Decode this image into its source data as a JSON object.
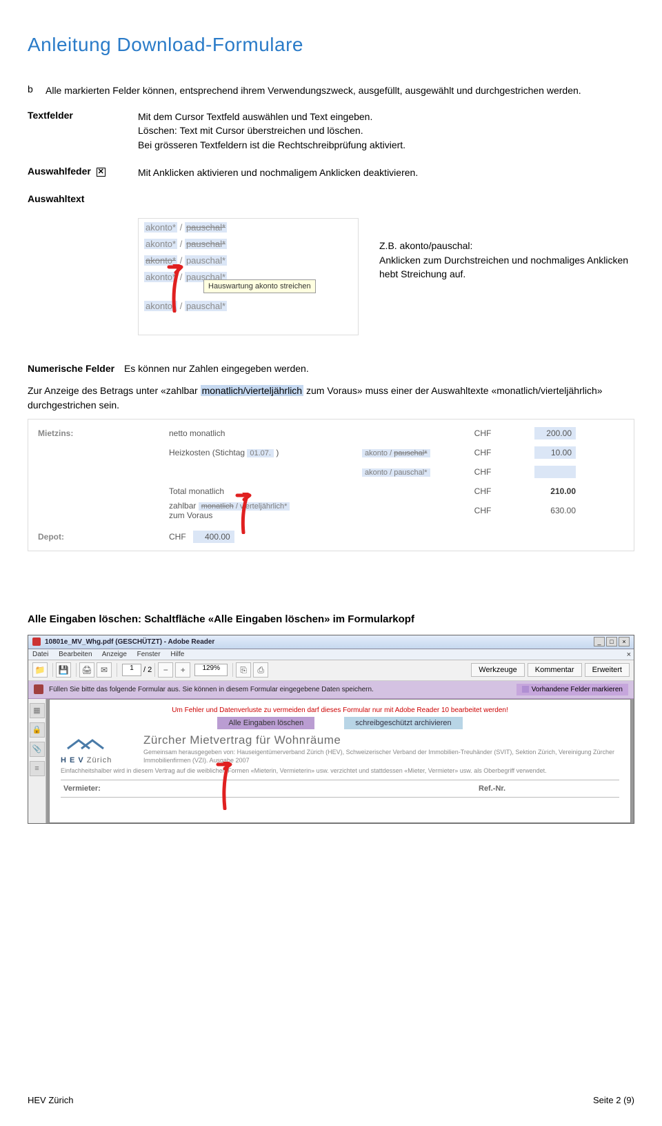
{
  "title": "Anleitung Download-Formulare",
  "intro": {
    "bullet": "b",
    "text": "Alle markierten Felder können, entsprechend ihrem Verwendungszweck, ausgefüllt, ausgewählt und durchgestrichen werden."
  },
  "defs": {
    "textfelder": {
      "term": "Textfelder",
      "desc": "Mit dem Cursor Textfeld auswählen und Text eingeben.\nLöschen: Text mit Cursor überstreichen und löschen.\nBei grösseren Textfeldern ist die Rechtschreibprüfung aktiviert."
    },
    "auswahlfeder": {
      "term": "Auswahlfeder",
      "box": "✕",
      "desc": "Mit Anklicken aktivieren und nochmaligem Anklicken deaktivieren."
    },
    "auswahltext": {
      "term": "Auswahltext"
    }
  },
  "example1": {
    "lines": [
      {
        "left": "akonto*",
        "right": "pauschal*",
        "struck": "right"
      },
      {
        "left": "akonto*",
        "right": "pauschal*",
        "struck": "right"
      },
      {
        "left": "akonto*",
        "right": "pauschal*",
        "struck": "left"
      },
      {
        "left": "akonto*",
        "right": "pauschal*",
        "struck": "none"
      },
      {
        "left": "akonto*",
        "right": "pauschal*",
        "struck": "none"
      }
    ],
    "tooltip": "Hauswartung akonto streichen",
    "caption": "Z.B. akonto/pauschal:\nAnklicken zum Durchstreichen und nochmaliges Anklicken hebt Streichung auf."
  },
  "numerische": {
    "label": "Numerische Felder",
    "desc": "Es können nur Zahlen eingegeben werden.",
    "note1": "Zur Anzeige des Betrags unter «zahlbar ",
    "noteHl": "monatlich/vierteljährlich",
    "note2": " zum Voraus» muss einer der Auswahltexte «monatlich/vierteljährlich» durchgestrichen sein."
  },
  "miet": {
    "mietzins": "Mietzins:",
    "r1": {
      "c2": "netto monatlich",
      "chf": "CHF",
      "amt": "200.00"
    },
    "r2": {
      "c2a": "Heizkosten (Stichtag ",
      "c2date": "01.07.",
      "c2b": " )",
      "c3": "akonto / pauschal*",
      "chf": "CHF",
      "amt": "10.00"
    },
    "r3": {
      "c3": "akonto / pauschal*",
      "chf": "CHF"
    },
    "r4": {
      "c2": "Total monatlich",
      "chf": "CHF",
      "amt": "210.00"
    },
    "r5": {
      "c2a": "zahlbar ",
      "c2m": "monatlich",
      "c2s": " / vierteljährlich*",
      "c2b": "zum Voraus",
      "chf": "CHF",
      "amt": "630.00"
    },
    "depot": {
      "lbl": "Depot:",
      "chf": "CHF",
      "amt": "400.00"
    }
  },
  "clear_heading": "Alle Eingaben löschen: Schaltfläche «Alle Eingaben löschen» im Formularkopf",
  "reader": {
    "title": "10801e_MV_Whg.pdf (GESCHÜTZT) - Adobe Reader",
    "menu": [
      "Datei",
      "Bearbeiten",
      "Anzeige",
      "Fenster",
      "Hilfe"
    ],
    "pg": "1",
    "pgof": "/ 2",
    "zoom": "129%",
    "rtabs": [
      "Werkzeuge",
      "Kommentar",
      "Erweitert"
    ],
    "purple": "Füllen Sie bitte das folgende Formular aus. Sie können in diesem Formular eingegebene Daten speichern.",
    "mark": "Vorhandene Felder markieren",
    "warn": "Um Fehler und Datenverluste zu vermeiden darf dieses Formular nur mit Adobe Reader 10 bearbeitet werden!",
    "btn1": "Alle Eingaben löschen",
    "btn2": "schreibgeschützt archivieren",
    "docTitle": "Zürcher Mietvertrag für Wohnräume",
    "docSub1": "Gemeinsam herausgegeben von: Hauseigentümerverband Zürich (HEV), Schweizerischer Verband der Immobilien-Treuhänder (SVIT), Sektion Zürich, Vereinigung Zürcher Immobilienfirmen (VZI). Ausgabe 2007",
    "docSub2": "Einfachheitshalber wird in diesem Vertrag auf die weiblichen Formen «Mieterin, Vermieterin» usw. verzichtet und stattdessen «Mieter, Vermieter» usw. als Oberbegriff verwendet.",
    "logo": "H E V",
    "logoCity": "Zürich",
    "formVermieter": "Vermieter:",
    "formRef": "Ref.-Nr."
  },
  "footer": {
    "left": "HEV Zürich",
    "right": "Seite  2 (9)"
  }
}
